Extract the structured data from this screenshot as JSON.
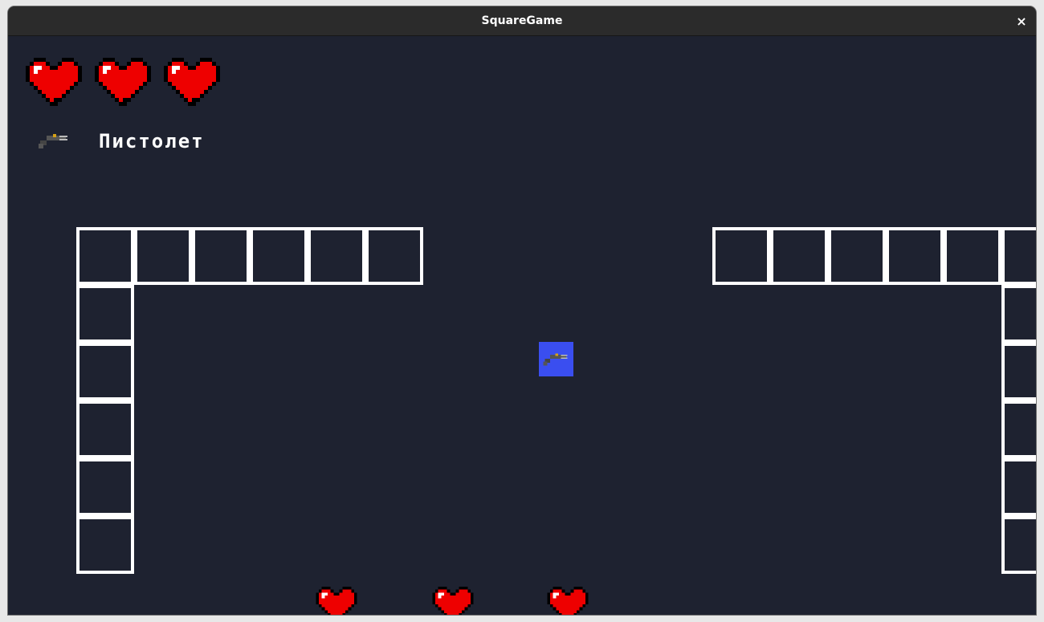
{
  "window": {
    "title": "SquareGame",
    "close_glyph": "×"
  },
  "hud": {
    "lives": 3,
    "heart_icon": "heart-icon",
    "weapon": {
      "name": "Пистолет",
      "icon": "pistol-icon"
    }
  },
  "pickups": [
    {
      "type": "heart",
      "icon": "heart-icon"
    },
    {
      "type": "heart",
      "icon": "heart-icon"
    },
    {
      "type": "heart",
      "icon": "heart-icon"
    }
  ],
  "player": {
    "held_item_icon": "pistol-icon"
  },
  "colors": {
    "background": "#1e2230",
    "wall_outline": "#ffffff",
    "player": "#3a4ef0",
    "heart": "#ff0000",
    "titlebar": "#2b2b2b"
  }
}
